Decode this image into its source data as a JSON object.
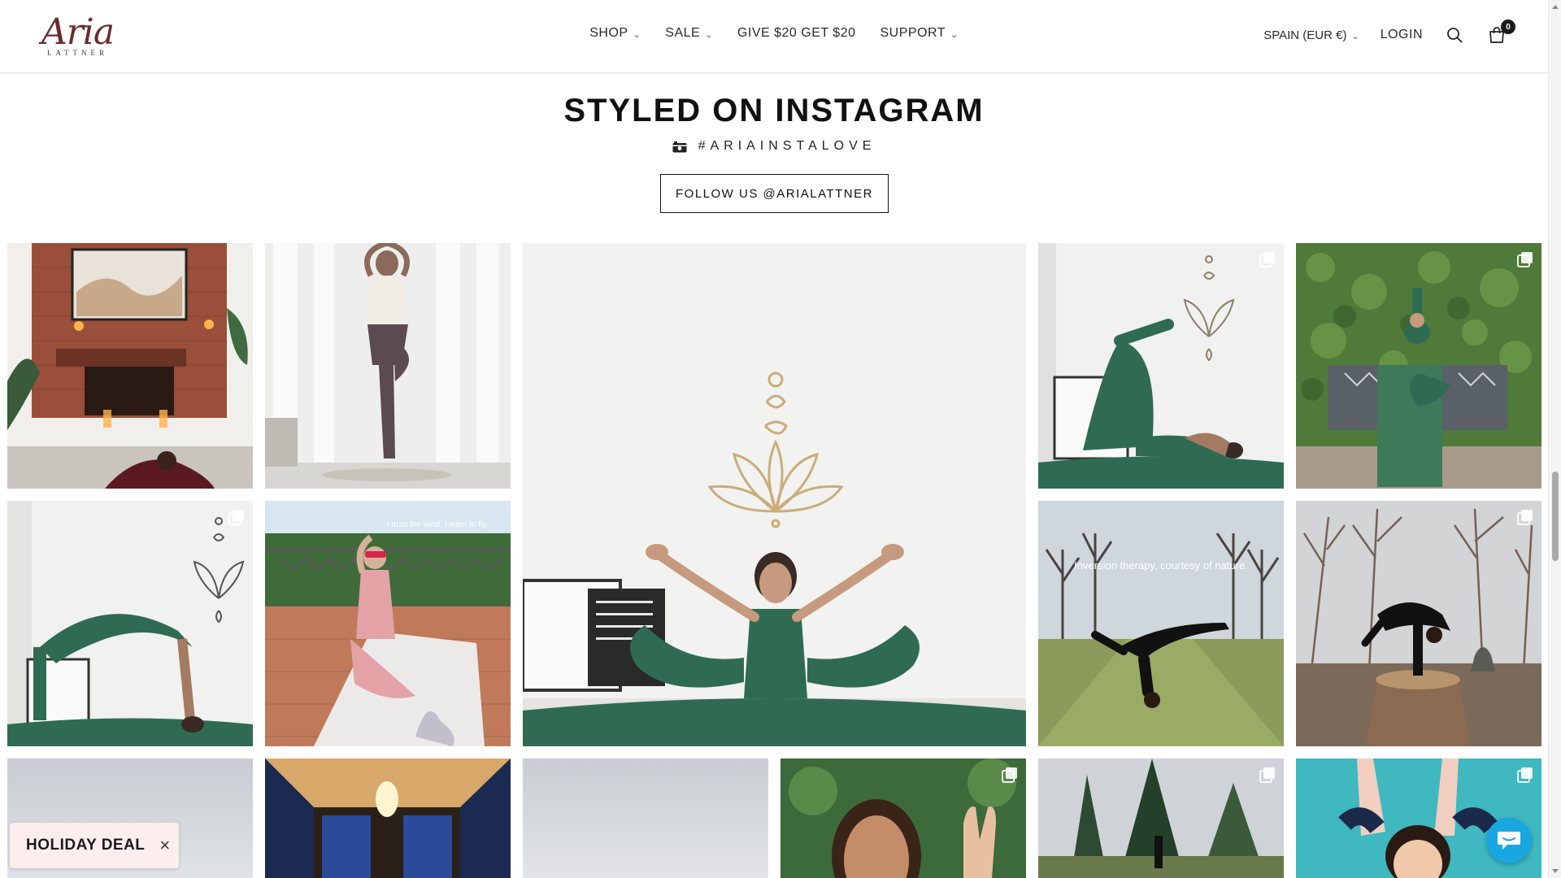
{
  "header": {
    "logo": {
      "main": "Aria",
      "sub": "LATTNER"
    },
    "nav": [
      {
        "label": "SHOP",
        "has_dropdown": true
      },
      {
        "label": "SALE",
        "has_dropdown": true
      },
      {
        "label": "GIVE $20 GET $20",
        "has_dropdown": false
      },
      {
        "label": "SUPPORT",
        "has_dropdown": true
      }
    ],
    "country": "SPAIN (EUR €)",
    "login": "LOGIN",
    "cart_count": "0",
    "icons": {
      "search": "search-icon",
      "cart": "bag-icon"
    }
  },
  "section": {
    "title": "STYLED ON INSTAGRAM",
    "hashtag": "#ARIAINSTALOVE",
    "hashtag_icon": "camera-icon",
    "follow_button": "FOLLOW US @ARIALATTNER"
  },
  "grid": {
    "tiles": [
      {
        "id": "fireplace",
        "scene": "fireplace",
        "multi": false
      },
      {
        "id": "tree-pose",
        "scene": "curtains",
        "multi": false
      },
      {
        "id": "featured",
        "scene": "featured",
        "multi": false
      },
      {
        "id": "lotus-stretch",
        "scene": "white-wall",
        "multi": true
      },
      {
        "id": "ivy-bench",
        "scene": "ivy",
        "multi": true
      },
      {
        "id": "wheel-pose",
        "scene": "white-wall",
        "multi": true
      },
      {
        "id": "balcony",
        "scene": "balcony",
        "multi": false,
        "overlay_text": "I trust the wind. I learn to fly."
      },
      {
        "id": "inversion",
        "scene": "field",
        "multi": false,
        "overlay_text": "Inversion therapy, courtesy of nature."
      },
      {
        "id": "stump",
        "scene": "woods",
        "multi": true
      },
      {
        "id": "sky-1",
        "scene": "sky",
        "multi": false
      },
      {
        "id": "lamp",
        "scene": "lamp",
        "multi": false
      },
      {
        "id": "sky-2",
        "scene": "sky",
        "multi": false
      },
      {
        "id": "portrait",
        "scene": "portrait",
        "multi": true
      },
      {
        "id": "pines",
        "scene": "pines",
        "multi": true
      },
      {
        "id": "teal",
        "scene": "teal",
        "multi": true
      }
    ]
  },
  "popup": {
    "label": "HOLIDAY DEAL",
    "close_icon": "close-icon"
  },
  "chat": {
    "icon": "chat-icon",
    "color": "#1aa6e0"
  },
  "colors": {
    "brand": "#6b2a2f",
    "green_outfit": "#2f6b53",
    "deal_bg": "#fbeeed"
  }
}
